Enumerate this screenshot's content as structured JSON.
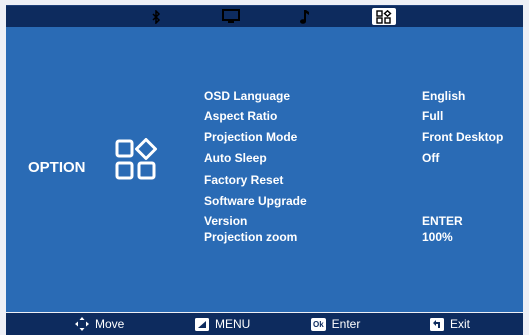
{
  "top_tabs": [
    {
      "name": "bluetooth",
      "icon": "bluetooth-icon",
      "active": false
    },
    {
      "name": "display",
      "icon": "monitor-icon",
      "active": false
    },
    {
      "name": "audio",
      "icon": "music-note-icon",
      "active": false
    },
    {
      "name": "option",
      "icon": "option-grid-icon",
      "active": true
    }
  ],
  "section": {
    "title": "OPTION",
    "icon": "option-grid-icon"
  },
  "menu": {
    "items": [
      {
        "label": "OSD Language",
        "value": "English"
      },
      {
        "label": "Aspect Ratio",
        "value": "Full"
      },
      {
        "label": "Projection Mode",
        "value": "Front Desktop"
      },
      {
        "label": "Auto Sleep",
        "value": "Off"
      },
      {
        "label": "Factory Reset",
        "value": ""
      },
      {
        "label": "Software Upgrade",
        "value": ""
      },
      {
        "label": "Version",
        "value": "ENTER"
      },
      {
        "label": "Projection zoom",
        "value": "100%"
      }
    ]
  },
  "bottom_hints": {
    "move": {
      "icon": "move-arrows-icon",
      "label": "Move"
    },
    "menu": {
      "icon": "menu-key-icon",
      "label": "MENU"
    },
    "enter": {
      "icon": "ok-key-icon",
      "key": "Ok",
      "label": "Enter"
    },
    "exit": {
      "icon": "return-key-icon",
      "label": "Exit"
    }
  },
  "colors": {
    "bar": "#0d2b5e",
    "panel": "#2a6bb5",
    "text": "#ffffff"
  }
}
